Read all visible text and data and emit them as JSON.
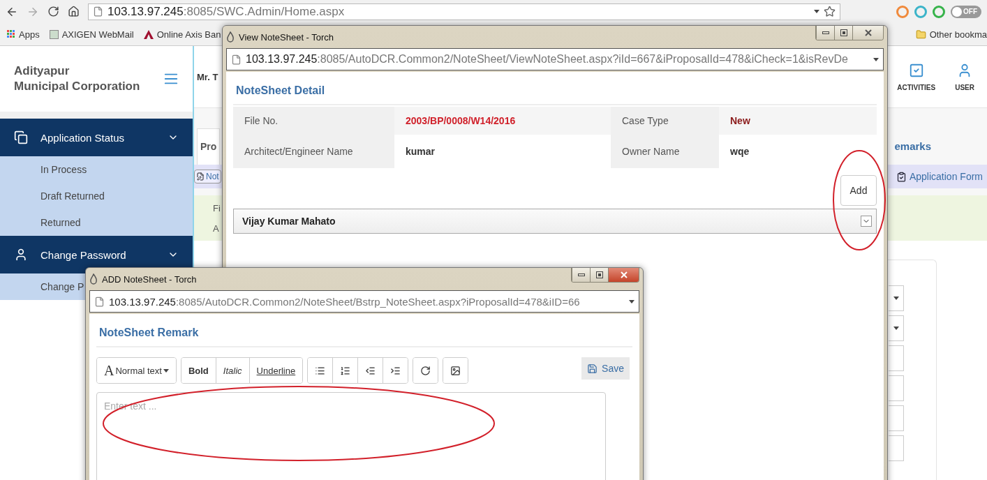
{
  "browser": {
    "url_host": "103.13.97.245",
    "url_path": ":8085/SWC.Admin/Home.aspx",
    "toggle": {
      "label": "OFF",
      "on": false
    },
    "bookmarks": [
      {
        "label": "Apps"
      },
      {
        "label": "AXIGEN WebMail"
      },
      {
        "label": "Online Axis Ban"
      }
    ],
    "other_bookmarks": "Other bookma"
  },
  "sidebar": {
    "brand_lines": [
      "Adityapur",
      "Municipal Corporation"
    ],
    "sections": [
      {
        "title": "Application Status",
        "expanded": true,
        "items": [
          "In Process",
          "Draft Returned",
          "Returned"
        ]
      },
      {
        "title": "Change Password",
        "expanded": true,
        "items": [
          "Change P"
        ]
      }
    ]
  },
  "header": {
    "user": "Mr. T",
    "actions": [
      {
        "label": "ACTIVITIES"
      },
      {
        "label": "USER"
      }
    ]
  },
  "main": {
    "tab": "Pro",
    "tab_right": "emarks",
    "note_button": "Not",
    "link": "Application Form",
    "info_labels": [
      "Fi",
      "A"
    ]
  },
  "view_window": {
    "title": "View NoteSheet - Torch",
    "url_host": "103.13.97.245",
    "url_path": ":8085/AutoDCR.Common2/NoteSheet/ViewNoteSheet.aspx?iId=667&iProposalId=478&iCheck=1&isRevDe",
    "heading": "NoteSheet Detail",
    "rows": [
      {
        "cells": [
          {
            "label": "File No.",
            "value": "2003/BP/0008/W14/2016",
            "color": "#d0202a"
          },
          {
            "label": "Case Type",
            "value": "New",
            "color": "#8b1a1a"
          }
        ]
      },
      {
        "cells": [
          {
            "label": "Architect/Engineer Name",
            "value": "kumar",
            "color": "#333333"
          },
          {
            "label": "Owner Name",
            "value": "wqe",
            "color": "#333333"
          }
        ]
      }
    ],
    "add_button": {
      "label": "Add",
      "highlighted": true
    },
    "accordion": {
      "title": "Vijay Kumar Mahato",
      "expanded": false
    }
  },
  "add_window": {
    "title": "ADD NoteSheet - Torch",
    "url_host": "103.13.97.245",
    "url_path": ":8085/AutoDCR.Common2/NoteSheet/Bstrp_NoteSheet.aspx?iProposalId=478&iID=66",
    "heading": "NoteSheet Remark",
    "style_menu": {
      "glyph": "A",
      "label": "Normal text"
    },
    "format_buttons": [
      {
        "label": "Bold",
        "kind": "bold"
      },
      {
        "label": "Italic",
        "kind": "italic"
      },
      {
        "label": "Underline",
        "kind": "underline"
      }
    ],
    "save": "Save",
    "editor": {
      "placeholder": "Enter text ...",
      "highlighted": true
    }
  }
}
